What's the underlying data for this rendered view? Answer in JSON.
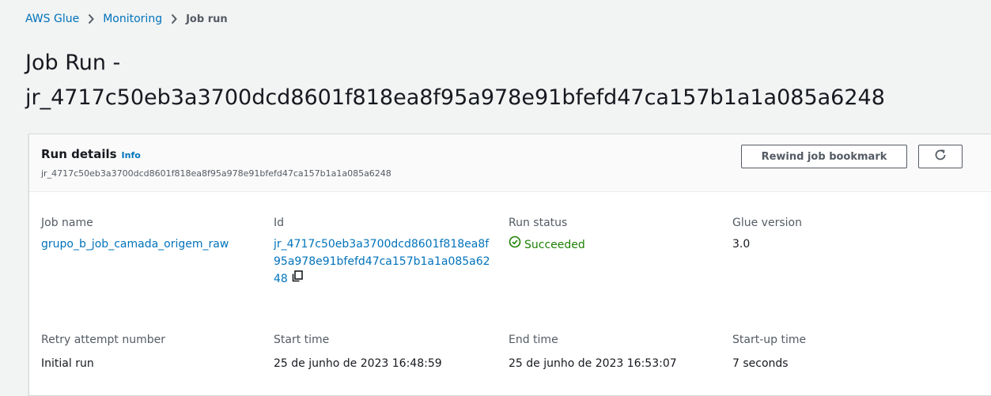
{
  "breadcrumb": {
    "items": [
      "AWS Glue",
      "Monitoring"
    ],
    "current": "Job run"
  },
  "page": {
    "title_line1": "Job Run -",
    "title_line2": "jr_4717c50eb3a3700dcd8601f818ea8f95a978e91bfefd47ca157b1a1a085a6248"
  },
  "card": {
    "title": "Run details",
    "info_label": "Info",
    "subtitle": "jr_4717c50eb3a3700dcd8601f818ea8f95a978e91bfefd47ca157b1a1a085a6248",
    "rewind_button": "Rewind job bookmark",
    "refresh_icon": "refresh-icon"
  },
  "fields": {
    "job_name": {
      "label": "Job name",
      "value": "grupo_b_job_camada_origem_raw"
    },
    "id": {
      "label": "Id",
      "lines": [
        "jr_4717c50eb3a3700dcd8601f818ea8f",
        "95a978e91bfefd47ca157b1a1a085a62",
        "48"
      ],
      "icon": "copy-icon"
    },
    "run_status": {
      "label": "Run status",
      "value": "Succeeded",
      "color": "#1d8102",
      "icon": "check-circle-icon"
    },
    "glue_version": {
      "label": "Glue version",
      "value": "3.0"
    },
    "retry_attempt": {
      "label": "Retry attempt number",
      "value": "Initial run"
    },
    "start_time": {
      "label": "Start time",
      "value": "25 de junho de 2023 16:48:59"
    },
    "end_time": {
      "label": "End time",
      "value": "25 de junho de 2023 16:53:07"
    },
    "startup_time": {
      "label": "Start-up time",
      "value": "7 seconds"
    }
  },
  "colors": {
    "link": "#0073bb",
    "success": "#1d8102",
    "background": "#f2f3f3"
  }
}
